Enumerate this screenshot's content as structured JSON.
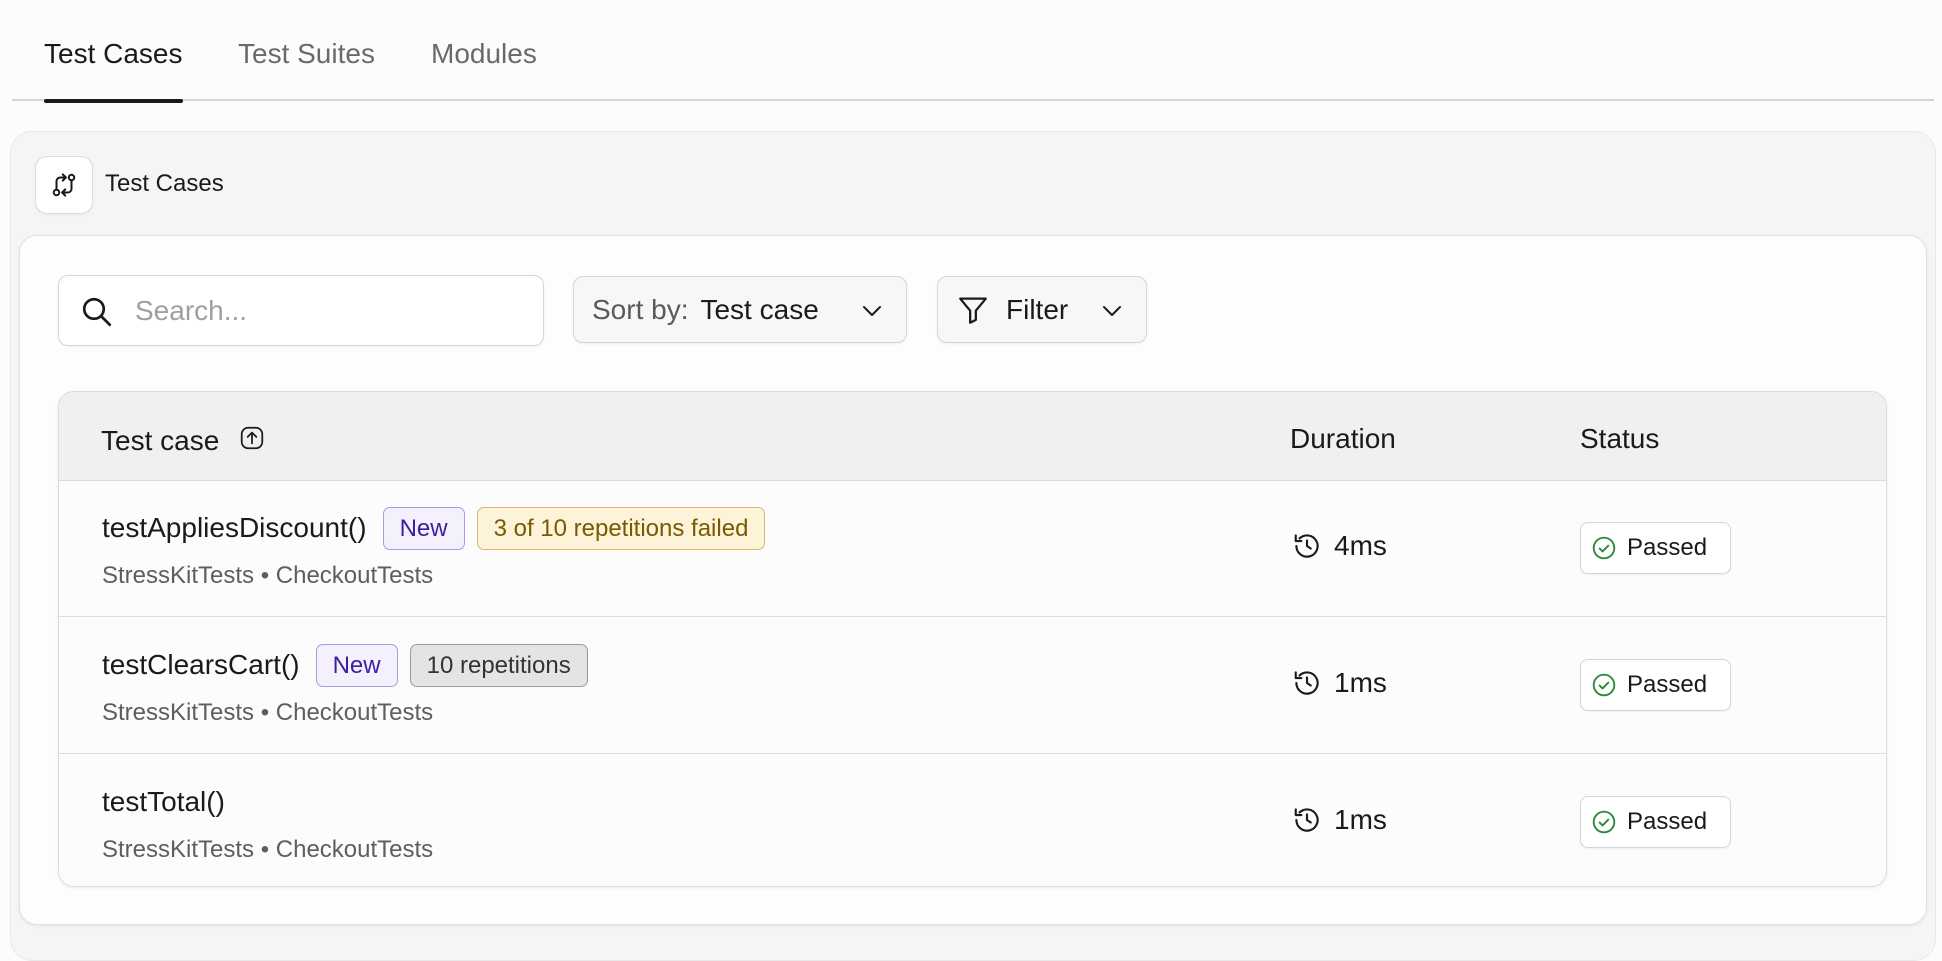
{
  "tabs": [
    {
      "label": "Test Cases",
      "active": true
    },
    {
      "label": "Test Suites",
      "active": false
    },
    {
      "label": "Modules",
      "active": false
    }
  ],
  "panel": {
    "title": "Test Cases",
    "icon": "git-compare-icon"
  },
  "toolbar": {
    "search_placeholder": "Search...",
    "sort_label": "Sort by:",
    "sort_value": "Test case",
    "filter_label": "Filter"
  },
  "table": {
    "headers": {
      "test_case": "Test case",
      "duration": "Duration",
      "status": "Status"
    },
    "rows": [
      {
        "name": "testAppliesDiscount()",
        "badge_new": "New",
        "badge_extra": "3 of 10 repetitions failed",
        "badge_extra_kind": "warning",
        "subtitle": "StressKitTests • CheckoutTests",
        "duration": "4ms",
        "status": "Passed"
      },
      {
        "name": "testClearsCart()",
        "badge_new": "New",
        "badge_extra": "10 repetitions",
        "badge_extra_kind": "neutral",
        "subtitle": "StressKitTests • CheckoutTests",
        "duration": "1ms",
        "status": "Passed"
      },
      {
        "name": "testTotal()",
        "subtitle": "StressKitTests • CheckoutTests",
        "duration": "1ms",
        "status": "Passed"
      }
    ]
  },
  "colors": {
    "status_passed": "#2e8b3c",
    "active_tab_underline": "#1a1a1a",
    "badge_new_text": "#3b1fa0",
    "badge_warning_text": "#7a5a00"
  }
}
